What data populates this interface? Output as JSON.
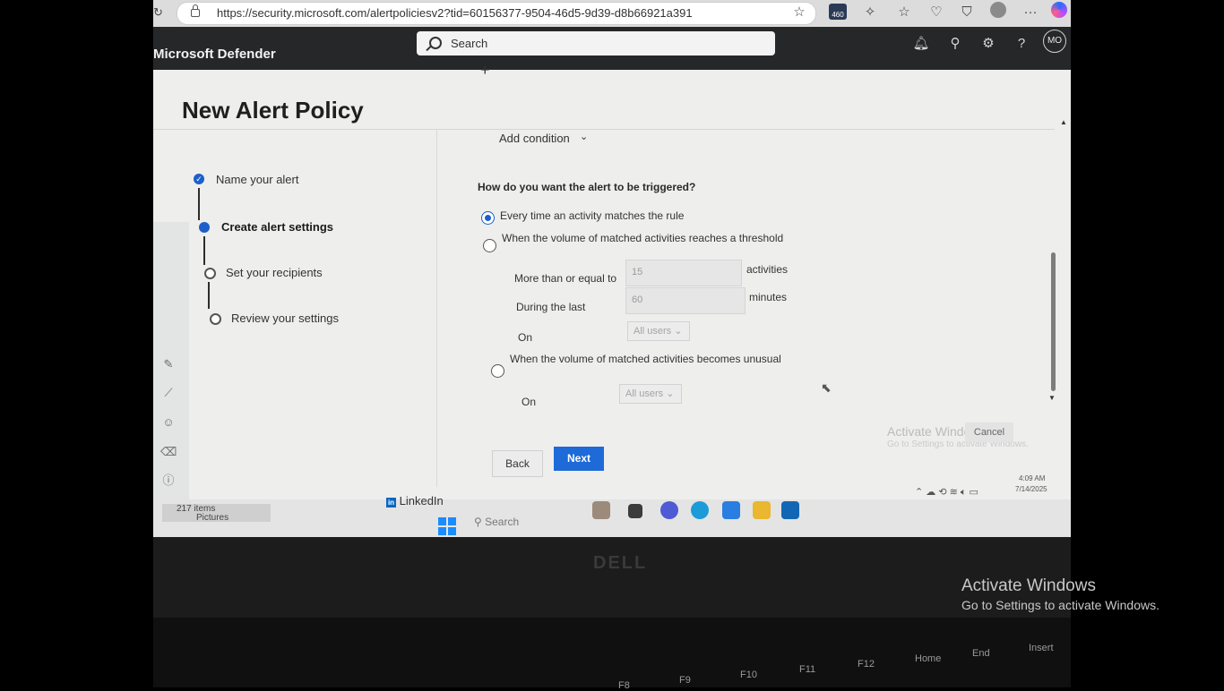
{
  "browser": {
    "url": "https://security.microsoft.com/alertpoliciesv2?tid=60156377-9504-46d5-9d39-d8b66921a391",
    "extension_badge": "460"
  },
  "header": {
    "app_title": "Microsoft Defender",
    "search_placeholder": "Search",
    "avatar_initials": "MO"
  },
  "page": {
    "title": "New Alert Policy"
  },
  "steps": [
    {
      "label": "Name your alert",
      "state": "done"
    },
    {
      "label": "Create alert settings",
      "state": "current"
    },
    {
      "label": "Set your recipients",
      "state": "todo"
    },
    {
      "label": "Review your settings",
      "state": "todo"
    }
  ],
  "form": {
    "add_condition_label": "Add condition",
    "trigger_question": "How do you want the alert to be triggered?",
    "option_every_time": "Every time an activity matches the rule",
    "option_threshold": "When the volume of matched activities reaches a threshold",
    "threshold_label": "More than or equal to",
    "threshold_value": "15",
    "threshold_unit": "activities",
    "during_label": "During the last",
    "during_value": "60",
    "during_unit": "minutes",
    "on_label": "On",
    "on_value": "All users",
    "option_unusual": "When the volume of matched activities becomes unusual",
    "unusual_on_label": "On",
    "unusual_on_value": "All users",
    "selected_option": "every_time"
  },
  "buttons": {
    "back": "Back",
    "next": "Next",
    "cancel": "Cancel"
  },
  "screen_watermark": {
    "title": "Activate Windows",
    "subtitle": "Go to Settings to activate Windows."
  },
  "taskbar": {
    "explorer_items": "217 items",
    "explorer_label": "Pictures",
    "linkedin": "LinkedIn",
    "search": "Search",
    "time": "4:09 AM",
    "date": "7/14/2025"
  },
  "laptop": {
    "brand": "DELL",
    "fkeys": [
      "F8",
      "F9",
      "F10",
      "F11",
      "F12",
      "Home",
      "End",
      "Insert"
    ]
  },
  "overlay_watermark": {
    "title": "Activate Windows",
    "subtitle": "Go to Settings to activate Windows."
  },
  "colors": {
    "accent": "#1d6ad8",
    "header_bg": "#252729",
    "page_bg": "#eeeeed"
  }
}
